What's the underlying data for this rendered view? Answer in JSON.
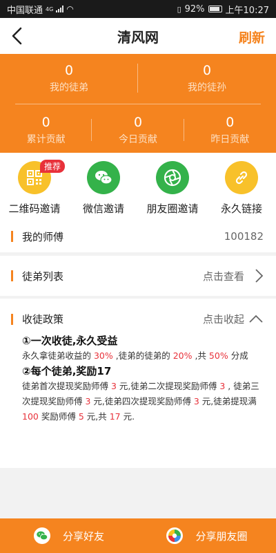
{
  "status": {
    "carrier": "中国联通",
    "network": "4G",
    "battery": "92%",
    "time": "上午10:27"
  },
  "header": {
    "title": "清风网",
    "refresh_label": "刷新"
  },
  "stats": {
    "row1": [
      {
        "value": "0",
        "label": "我的徒弟"
      },
      {
        "value": "0",
        "label": "我的徒孙"
      }
    ],
    "row2": [
      {
        "value": "0",
        "label": "累计贡献"
      },
      {
        "value": "0",
        "label": "今日贡献"
      },
      {
        "value": "0",
        "label": "昨日贡献"
      }
    ]
  },
  "invites": [
    {
      "label": "二维码邀请",
      "icon": "qrcode-icon",
      "color": "#f8c12a",
      "badge": "推荐"
    },
    {
      "label": "微信邀请",
      "icon": "wechat-icon",
      "color": "#34b24a"
    },
    {
      "label": "朋友圈邀请",
      "icon": "moments-icon",
      "color": "#34b24a"
    },
    {
      "label": "永久链接",
      "icon": "link-icon",
      "color": "#f8c12a"
    }
  ],
  "master": {
    "label": "我的师傅",
    "value": "100182"
  },
  "apprentices": {
    "label": "徒弟列表",
    "link": "点击查看"
  },
  "policy": {
    "label": "收徒政策",
    "link": "点击收起",
    "h1": "①一次收徒,永久受益",
    "p1": [
      {
        "t": "永久拿徒弟收益的 "
      },
      {
        "t": "30%",
        "hl": true
      },
      {
        "t": " ,徒弟的徒弟的 "
      },
      {
        "t": "20%",
        "hl": true
      },
      {
        "t": " ,共 "
      },
      {
        "t": "50%",
        "hl": true
      },
      {
        "t": " 分成"
      }
    ],
    "h2": "②每个徒弟,奖励17",
    "p2": [
      {
        "t": "徒弟首次提现奖励师傅 "
      },
      {
        "t": "3",
        "hl": true
      },
      {
        "t": " 元,徒弟二次提现奖励师傅 "
      },
      {
        "t": "3",
        "hl": true
      },
      {
        "t": " , 徒弟三次提现奖励师傅 "
      },
      {
        "t": "3",
        "hl": true
      },
      {
        "t": " 元,徒弟四次提现奖励师傅 "
      },
      {
        "t": "3",
        "hl": true
      },
      {
        "t": " 元,徒弟提现满 "
      },
      {
        "t": "100",
        "hl": true
      },
      {
        "t": " 奖励师傅 "
      },
      {
        "t": "5",
        "hl": true
      },
      {
        "t": " 元,共 "
      },
      {
        "t": "17",
        "hl": true
      },
      {
        "t": " 元."
      }
    ]
  },
  "bottom": {
    "share_friends": "分享好友",
    "share_moments": "分享朋友圈"
  },
  "colors": {
    "accent": "#f5841f",
    "highlight": "#e8313a"
  }
}
